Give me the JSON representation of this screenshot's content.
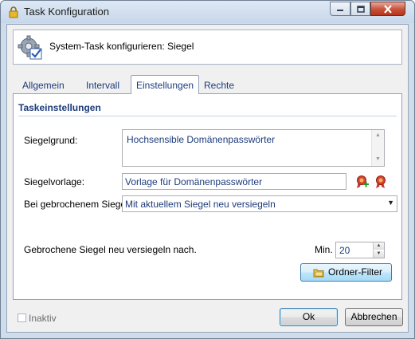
{
  "window": {
    "title": "Task Konfiguration"
  },
  "header": {
    "text": "System-Task konfigurieren: Siegel"
  },
  "tabs": [
    {
      "label": "Allgemein"
    },
    {
      "label": "Intervall"
    },
    {
      "label": "Einstellungen"
    },
    {
      "label": "Rechte"
    }
  ],
  "active_tab": "Einstellungen",
  "section": {
    "title": "Taskeinstellungen"
  },
  "form": {
    "reason_label": "Siegelgrund:",
    "reason_value": "Hochsensible Domänenpasswörter",
    "template_label": "Siegelvorlage:",
    "template_value": "Vorlage für Domänenpasswörter",
    "broken_label": "Bei gebrochenem Siegel:",
    "broken_value": "Mit aktuellem Siegel neu versiegeln",
    "reseal_label": "Gebrochene Siegel neu versiegeln nach.",
    "min_label": "Min.",
    "min_value": "20",
    "folder_filter_label": "Ordner-Filter"
  },
  "footer": {
    "inactive_label": "Inaktiv",
    "inactive_checked": false,
    "ok_label": "Ok",
    "cancel_label": "Abbrechen"
  },
  "colors": {
    "accent_text": "#1d3b7b",
    "title_bar": "#c7d7ea",
    "close_button": "#c7513a"
  },
  "icons": [
    "lock-icon",
    "minimize-icon",
    "maximize-icon",
    "close-icon",
    "gear-check-icon",
    "seal-add-icon",
    "seal-icon",
    "folder-icon"
  ]
}
